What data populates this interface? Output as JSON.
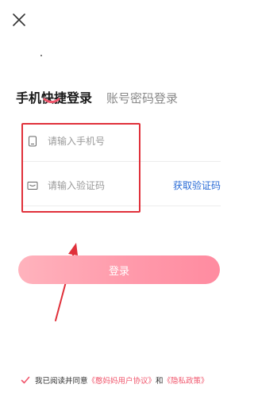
{
  "header": {
    "close_icon": "close-icon"
  },
  "tabs": [
    {
      "label": "手机快捷登录",
      "active": true
    },
    {
      "label": "账号密码登录",
      "active": false
    }
  ],
  "form": {
    "phone": {
      "placeholder": "请输入手机号",
      "icon": "phone-icon"
    },
    "code": {
      "placeholder": "请输入验证码",
      "icon": "message-icon",
      "get_code_label": "获取验证码"
    }
  },
  "login_label": "登录",
  "agreement": {
    "prefix": "我已阅读并同意",
    "user_agreement": "《憨妈妈用户协议》",
    "and": "和",
    "privacy": "《隐私政策》",
    "checked": true
  },
  "colors": {
    "accent": "#f0566c",
    "link_blue": "#2a6bd6",
    "highlight_red": "#e0303a",
    "button_gradient_start": "#ffb3bd",
    "button_gradient_end": "#ff8ba0"
  }
}
